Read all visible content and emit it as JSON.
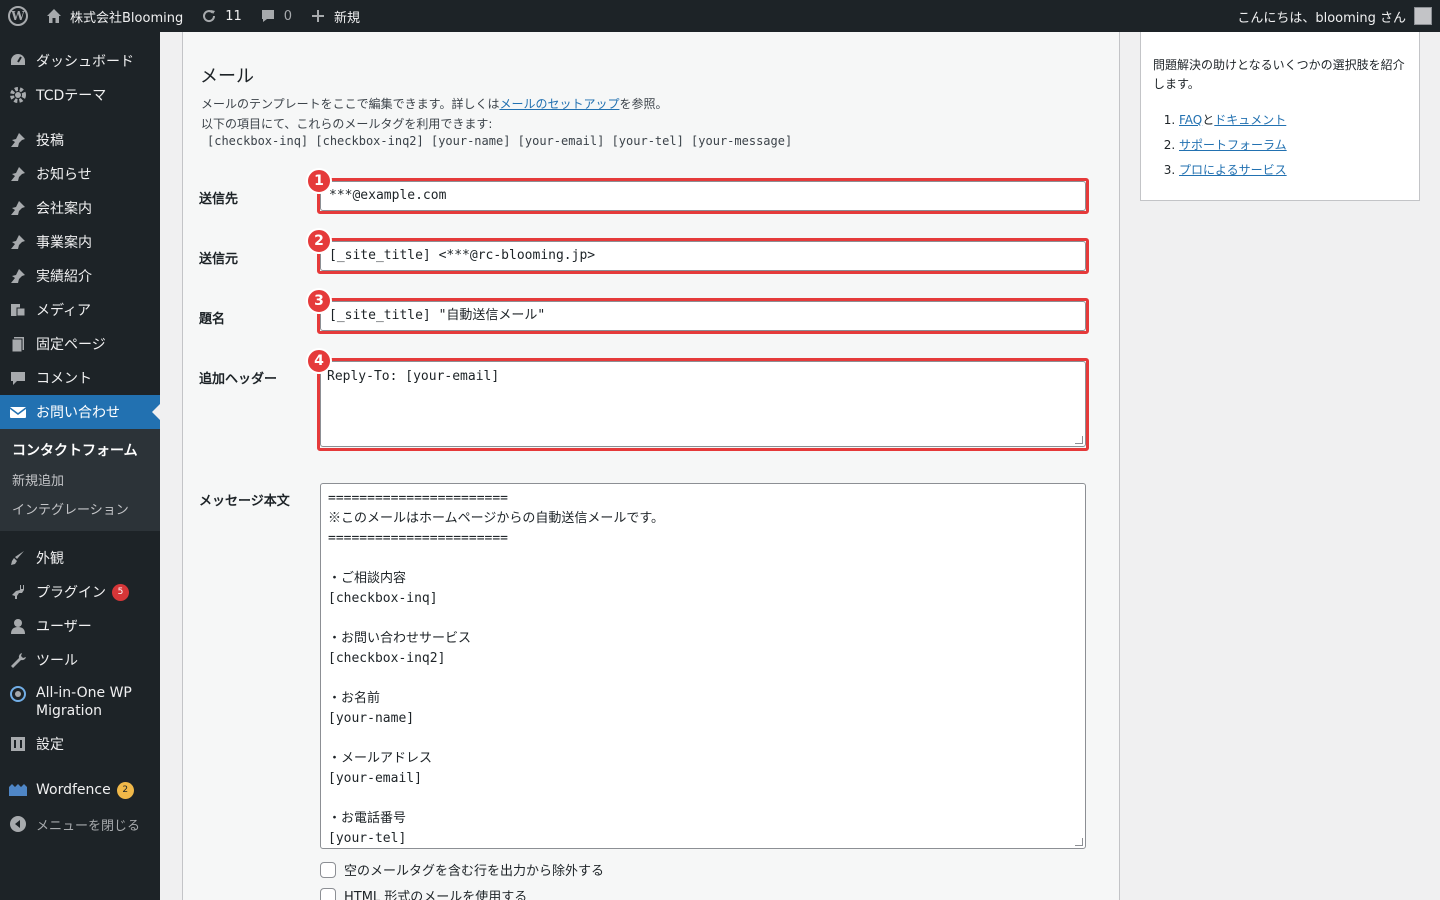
{
  "adminbar": {
    "site_name": "株式会社Blooming",
    "updates_count": "11",
    "comments_count": "0",
    "new_label": "新規",
    "greeting": "こんにちは、blooming さん"
  },
  "sidebar": {
    "items": [
      {
        "label": "ダッシュボード",
        "icon": "dashboard-icon"
      },
      {
        "label": "TCDテーマ",
        "icon": "gear-icon"
      },
      {
        "label": "投稿",
        "icon": "pin-icon"
      },
      {
        "label": "お知らせ",
        "icon": "pin-icon"
      },
      {
        "label": "会社案内",
        "icon": "pin-icon"
      },
      {
        "label": "事業案内",
        "icon": "pin-icon"
      },
      {
        "label": "実績紹介",
        "icon": "pin-icon"
      },
      {
        "label": "メディア",
        "icon": "media-icon"
      },
      {
        "label": "固定ページ",
        "icon": "page-icon"
      },
      {
        "label": "コメント",
        "icon": "comment-icon"
      },
      {
        "label": "お問い合わせ",
        "icon": "mail-icon"
      },
      {
        "label": "外観",
        "icon": "brush-icon"
      },
      {
        "label": "プラグイン",
        "icon": "plugin-icon",
        "badge": "5"
      },
      {
        "label": "ユーザー",
        "icon": "user-icon"
      },
      {
        "label": "ツール",
        "icon": "wrench-icon"
      },
      {
        "label": "All-in-One WP Migration",
        "icon": "migration-icon"
      },
      {
        "label": "設定",
        "icon": "settings-icon"
      },
      {
        "label": "Wordfence",
        "icon": "wordfence-icon",
        "badge": "2"
      },
      {
        "label": "メニューを閉じる",
        "icon": "collapse-icon"
      }
    ],
    "submenu": [
      "コンタクトフォーム",
      "新規追加",
      "インテグレーション"
    ]
  },
  "mail": {
    "title": "メール",
    "desc_prefix": "メールのテンプレートをここで編集できます。詳しくは",
    "desc_link": "メールのセットアップ",
    "desc_suffix": "を参照。",
    "desc_line2": "以下の項目にて、これらのメールタグを利用できます:",
    "tags": "[checkbox-inq] [checkbox-inq2] [your-name] [your-email] [your-tel] [your-message]",
    "to_label": "送信先",
    "to_value": "***@example.com",
    "from_label": "送信元",
    "from_value": "[_site_title] <***@rc-blooming.jp>",
    "subject_label": "題名",
    "subject_value": "[_site_title] \"自動送信メール\"",
    "headers_label": "追加ヘッダー",
    "headers_value": "Reply-To: [your-email]",
    "body_label": "メッセージ本文",
    "body_lines": [
      "=======================",
      "※このメールはホームページからの自動送信メールです。",
      "=======================",
      "",
      "・ご相談内容",
      "[checkbox-inq]",
      "",
      "・お問い合わせサービス",
      "[checkbox-inq2]",
      "",
      "・お名前",
      "[your-name]",
      "",
      "・メールアドレス",
      "[your-email]",
      "",
      "・お電話番号",
      "[your-tel]"
    ],
    "exclude_blank_label": "空のメールタグを含む行を出力から除外する",
    "html_label": "HTML 形式のメールを使用する",
    "callouts": [
      "1",
      "2",
      "3",
      "4"
    ]
  },
  "help": {
    "text": "問題解決の助けとなるいくつかの選択肢を紹介します。",
    "links": [
      {
        "n": "1.",
        "a": "FAQ",
        "mid": "と",
        "b": "ドキュメント"
      },
      {
        "n": "2.",
        "a": "サポートフォーラム"
      },
      {
        "n": "3.",
        "a": "プロによるサービス"
      }
    ]
  },
  "colors": {
    "accent": "#2271b1",
    "highlight": "#e53a3a",
    "adminbar": "#1d2327"
  }
}
